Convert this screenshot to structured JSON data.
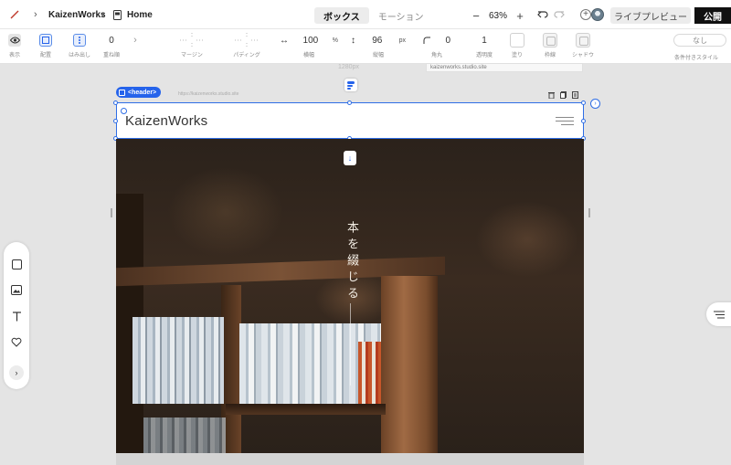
{
  "topbar": {
    "project_name": "KaizenWorks",
    "page_name": "Home",
    "tabs": [
      "ボックス",
      "モーション"
    ],
    "zoom": "63%",
    "zoom_out": "−",
    "zoom_in": "+",
    "add_member": "+",
    "live_preview": "ライブプレビュー",
    "publish": "公開"
  },
  "props": {
    "display": "表示",
    "layout": "配置",
    "overflow": "はみ出し",
    "zindex_value": "0",
    "zindex": "重ね順",
    "margin": "マージン",
    "padding": "パディング",
    "width_value": "100",
    "width_unit": "%",
    "width": "横幅",
    "height_value": "96",
    "height_unit": "px",
    "height": "縦幅",
    "radius_value": "0",
    "radius": "角丸",
    "opacity_value": "1",
    "opacity": "透明度",
    "fill": "塗り",
    "border": "枠線",
    "shadow": "シャドウ",
    "conditional_value": "なし",
    "conditional": "条件付きスタイル"
  },
  "canvas": {
    "ruler_label": "1280px",
    "url_tag": "kaizenworks.studio.site",
    "site_url_faint": "https://kaizenworks.studio.site",
    "element_tag": "<header>",
    "next_arrow": "›"
  },
  "site": {
    "logo": "KaizenWorks",
    "hero_title": "本を綴じる",
    "down_arrow": "↓"
  },
  "toolbar": {
    "more": "›"
  },
  "colors": {
    "accent": "#2563eb",
    "publish_bg": "#111111"
  }
}
